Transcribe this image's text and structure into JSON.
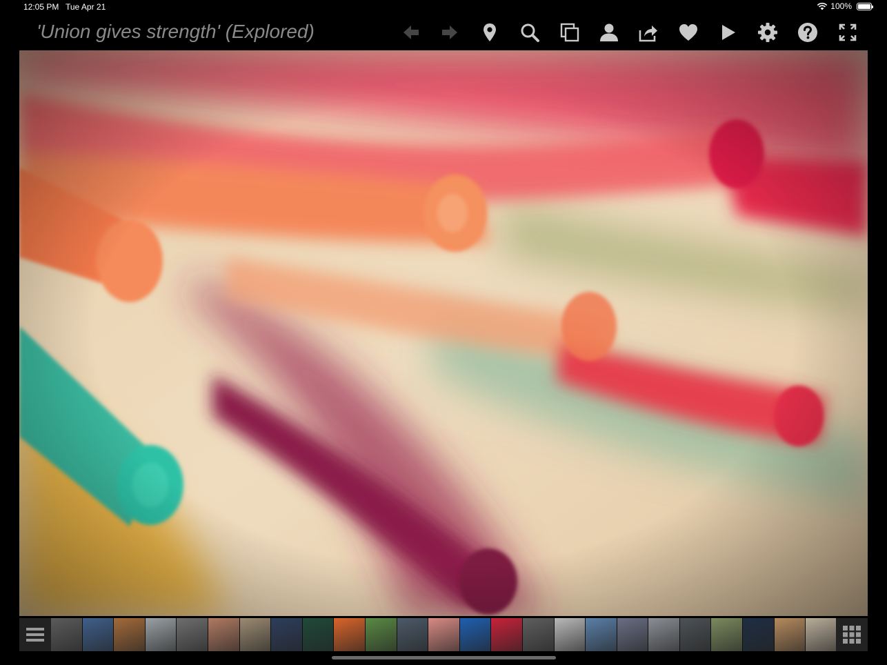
{
  "status_bar": {
    "time": "12:05 PM",
    "date": "Tue Apr 21",
    "battery": "100%"
  },
  "header": {
    "title": "'Union gives strength' (Explored)"
  },
  "toolbar": {
    "icon_color": "#c9c9c9",
    "buttons": [
      {
        "name": "back-arrow-icon",
        "enabled": false
      },
      {
        "name": "forward-arrow-icon",
        "enabled": false
      },
      {
        "name": "map-pin-icon",
        "enabled": true
      },
      {
        "name": "search-icon",
        "enabled": true
      },
      {
        "name": "copy-icon",
        "enabled": true
      },
      {
        "name": "user-icon",
        "enabled": true
      },
      {
        "name": "share-icon",
        "enabled": true
      },
      {
        "name": "heart-icon",
        "enabled": true
      },
      {
        "name": "play-icon",
        "enabled": true
      },
      {
        "name": "gear-icon",
        "enabled": true
      },
      {
        "name": "help-icon",
        "enabled": true
      },
      {
        "name": "fullscreen-icon",
        "enabled": true
      }
    ]
  },
  "filmstrip": {
    "left_button": "list-icon",
    "right_button": "grid-icon",
    "thumbnails": [
      "#5b5b5b",
      "#3f5f8a",
      "#a36a3a",
      "#9aa0a4",
      "#6e6e6e",
      "#b07a62",
      "#9b8a72",
      "#2d3e5c",
      "#1f4a3a",
      "#d9642a",
      "#5a8a44",
      "#4c5a68",
      "#d98a84",
      "#1f5fb0",
      "#c8223a",
      "#5e5e5e",
      "#b9b9b9",
      "#5a7fa8",
      "#6a6e84",
      "#8a8e94",
      "#4d5256",
      "#7b8a5e",
      "#1f2e44",
      "#b58a5e",
      "#b9ad9a"
    ]
  }
}
